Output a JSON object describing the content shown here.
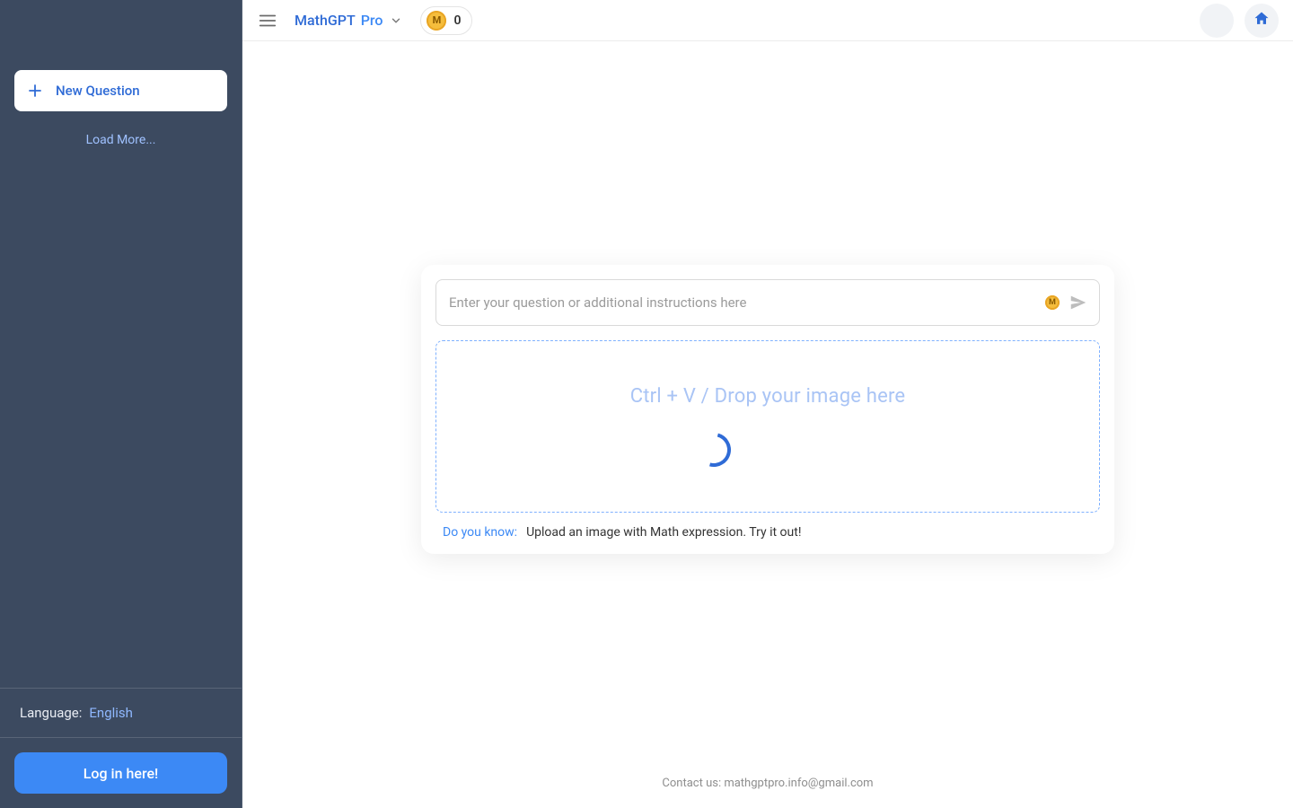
{
  "brand": {
    "main": "MathGPT",
    "sub": "Pro"
  },
  "coin": {
    "glyph": "M",
    "value": "0"
  },
  "sidebar": {
    "new_question_label": "New Question",
    "load_more_label": "Load More...",
    "language_label": "Language:",
    "language_value": "English",
    "login_label": "Log in here!"
  },
  "input": {
    "placeholder": "Enter your question or additional instructions here"
  },
  "dropzone": {
    "text": "Ctrl + V / Drop your image here"
  },
  "hint": {
    "label": "Do you know:",
    "text": "Upload an image with Math expression. Try it out!"
  },
  "footer": {
    "text": "Contact us: mathgptpro.info@gmail.com"
  }
}
